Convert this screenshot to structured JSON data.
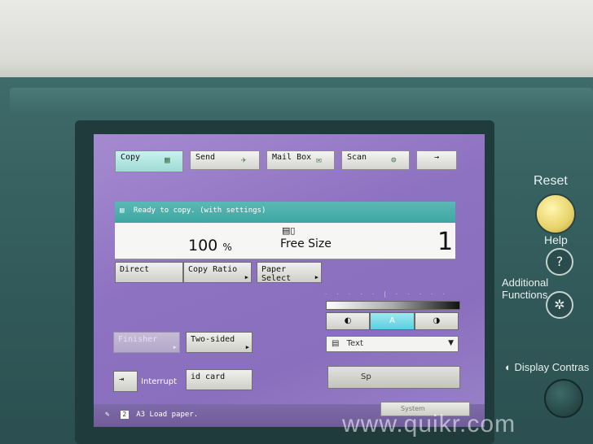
{
  "tabs": [
    {
      "label": "Copy",
      "icon": "copy-icon"
    },
    {
      "label": "Send",
      "icon": "send-icon"
    },
    {
      "label": "Mail Box",
      "icon": "mailbox-icon"
    },
    {
      "label": "Scan",
      "icon": "scan-icon"
    },
    {
      "label": "→",
      "icon": "arrow-right-icon"
    }
  ],
  "status": {
    "message": "Ready to copy. (with settings)"
  },
  "copy_settings": {
    "ratio_value": "100",
    "ratio_unit": "%",
    "paper_size": "Free Size",
    "quantity": "1"
  },
  "buttons": {
    "direct": "Direct",
    "copy_ratio": "Copy Ratio",
    "paper_select": "Paper Select",
    "finisher": "Finisher",
    "two_sided": "Two-sided",
    "interrupt": "Interrupt",
    "id_card": "id card",
    "special_features": "Sp"
  },
  "density": {
    "light": "◐",
    "auto": "A",
    "dark": "◑",
    "scale": "· · · · · | · · · · ·"
  },
  "original_type": {
    "selected": "Text"
  },
  "bottom_bar": {
    "tray_number": "2",
    "message": "A3 Load paper.",
    "system_monitor": "System"
  },
  "hardware": {
    "reset": "Reset",
    "help": "Help",
    "help_icon": "?",
    "additional_functions": "Additional Functions",
    "additional_icon": "✲",
    "display_contrast": "Display Contras"
  },
  "watermark": "www.quikr.com",
  "colors": {
    "accent": "#3ea6a1",
    "screen": "#8e72c2",
    "housing": "#355e5e"
  }
}
